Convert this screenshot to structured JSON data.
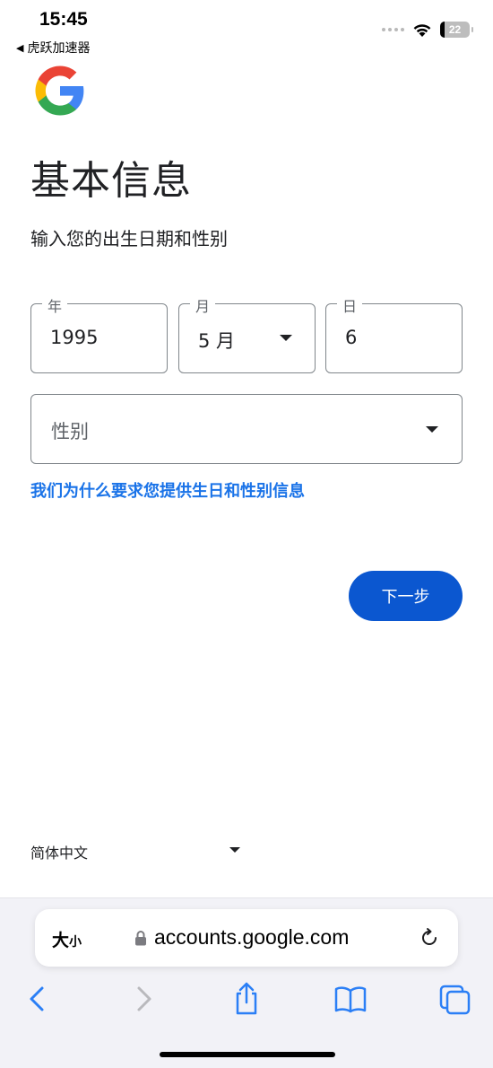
{
  "status_bar": {
    "time": "15:45",
    "back_app": "虎跃加速器",
    "battery": "22"
  },
  "brand": {
    "logo_icon": "google-g-logo",
    "colors": {
      "blue": "#4285F4",
      "red": "#EA4335",
      "yellow": "#FBBC05",
      "green": "#34A853"
    }
  },
  "page": {
    "title": "基本信息",
    "subtitle": "输入您的出生日期和性别"
  },
  "form": {
    "year": {
      "label": "年",
      "value": "1995"
    },
    "month": {
      "label": "月",
      "value": "5 月"
    },
    "day": {
      "label": "日",
      "value": "6"
    },
    "gender": {
      "placeholder": "性别"
    }
  },
  "why_link": "我们为什么要求您提供生日和性别信息",
  "next_button": "下一步",
  "footer": {
    "language": "简体中文"
  },
  "browser": {
    "text_size_large": "大",
    "text_size_small": "小",
    "url": "accounts.google.com",
    "icons": [
      "back-icon",
      "forward-icon",
      "share-icon",
      "bookmarks-icon",
      "tabs-icon"
    ]
  },
  "accent_color": "#0b57d0",
  "link_color": "#1a73e8"
}
